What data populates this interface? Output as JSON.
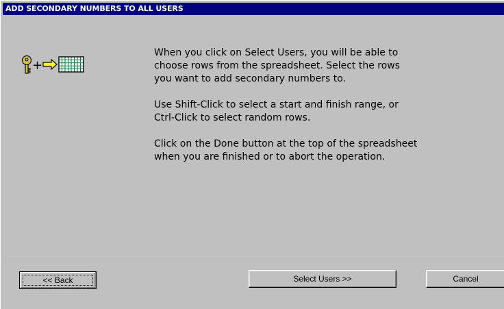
{
  "window": {
    "title": "ADD SECONDARY NUMBERS TO ALL USERS"
  },
  "icons": {
    "key": "key-icon",
    "plus": "+",
    "arrow": "right-arrow-icon",
    "grid": "spreadsheet-grid-icon"
  },
  "instructions": {
    "paragraph1": "When you click on Select Users, you will be able to\nchoose rows from the spreadsheet.  Select the rows\nyou want to add secondary numbers to.",
    "paragraph2": "Use Shift-Click to select a start and finish range, or\nCtrl-Click to select random rows.",
    "paragraph3": "Click on the Done button at the top of the spreadsheet\nwhen you are finished or to abort the operation."
  },
  "buttons": {
    "back_label": "<< Back",
    "select_users_label": "Select Users >>",
    "cancel_label": "Cancel"
  },
  "colors": {
    "title_bar": "#000080",
    "face": "#c0c0c0",
    "key": "#d4c24a",
    "arrow": "#ffff00",
    "grid": "#007a3d"
  }
}
